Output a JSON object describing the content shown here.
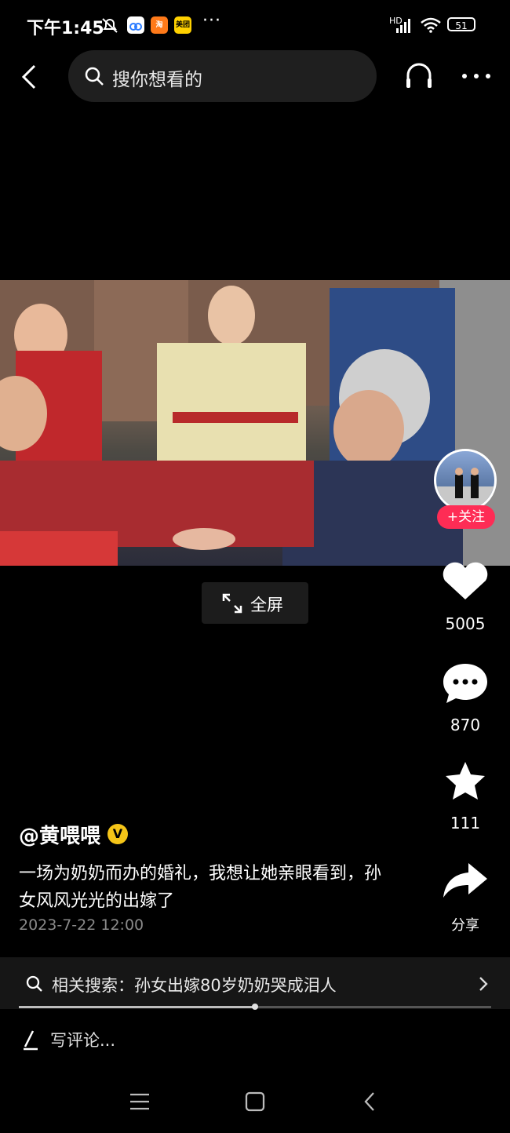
{
  "status_bar": {
    "time": "下午1:45",
    "apps": [
      {
        "name": "cloud-app-icon",
        "label": "",
        "color": "#ffffff"
      },
      {
        "name": "taobao-app-icon",
        "label": "淘",
        "color": "#ff7a1a"
      },
      {
        "name": "meituan-app-icon",
        "label": "美团",
        "color": "#ffd100"
      }
    ],
    "more": "···",
    "network": "HD",
    "battery": "51"
  },
  "nav": {
    "search_placeholder": "搜你想看的"
  },
  "video": {
    "fullscreen_label": "全屏"
  },
  "rail": {
    "follow_label": "+关注",
    "likes": "5005",
    "comments": "870",
    "favorites": "111",
    "share_label": "分享"
  },
  "post": {
    "username": "@黄喂喂",
    "verified_mark": "V",
    "description": "一场为奶奶而办的婚礼，我想让她亲眼看到，孙女风风光光的出嫁了",
    "date": "2023-7-22 12:00"
  },
  "related": {
    "text": "相关搜索：孙女出嫁80岁奶奶哭成泪人"
  },
  "progress": {
    "fraction": 0.5
  },
  "comment": {
    "placeholder": "写评论..."
  },
  "colors": {
    "accent": "#fe2c55",
    "verified": "#f5c518"
  }
}
